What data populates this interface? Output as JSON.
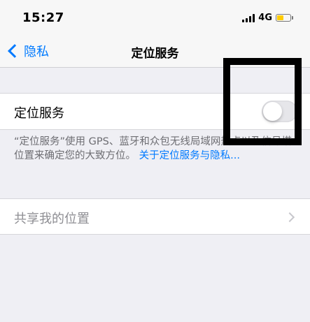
{
  "status_bar": {
    "time": "15:27",
    "network": "4G",
    "battery_level": 0.5,
    "battery_color": "#ffcc00"
  },
  "nav": {
    "back_label": "隐私",
    "title": "定位服务",
    "accent_color": "#007aff"
  },
  "location_services": {
    "label": "定位服务",
    "toggle_on": false
  },
  "footer": {
    "text": "“定位服务”使用 GPS、蓝牙和众包无线局域网热点以及信号塔位置来确定您的大致方位。",
    "link": "关于定位服务与隐私..."
  },
  "share_location": {
    "label": "共享我的位置",
    "disabled": true
  },
  "icons": {
    "back": "chevron-left-icon",
    "row": "chevron-right-icon",
    "signal": "signal-bars-icon",
    "battery": "battery-icon"
  }
}
